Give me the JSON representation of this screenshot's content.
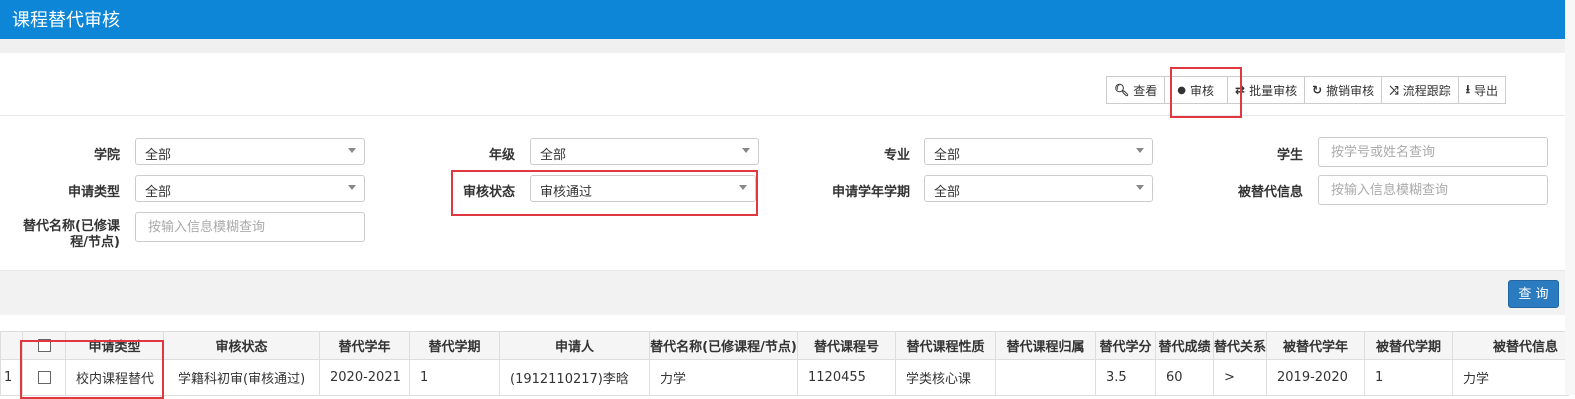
{
  "title": "课程替代审核",
  "toolbar": {
    "buttons": [
      {
        "icon": "search-icon",
        "glyph": "🔍︎",
        "label": "查看"
      },
      {
        "icon": "drop-icon",
        "glyph": "●",
        "label": "审核"
      },
      {
        "icon": "transfer-icon",
        "glyph": "⇄",
        "label": "批量审核"
      },
      {
        "icon": "refresh-icon",
        "glyph": "↻",
        "label": "撤销审核"
      },
      {
        "icon": "shuffle-icon",
        "glyph": "⤨",
        "label": "流程跟踪"
      },
      {
        "icon": "export-icon",
        "glyph": "⭳",
        "label": "导出"
      }
    ]
  },
  "filters": {
    "college_label": "学院",
    "college_value": "全部",
    "grade_label": "年级",
    "grade_value": "全部",
    "major_label": "专业",
    "major_value": "全部",
    "student_label": "学生",
    "student_placeholder": "按学号或姓名查询",
    "apptype_label": "申请类型",
    "apptype_value": "全部",
    "status_label": "审核状态",
    "status_value": "审核通过",
    "term_label": "申请学年学期",
    "term_value": "全部",
    "replaced_label": "被替代信息",
    "replaced_placeholder": "按输入信息模糊查询",
    "subname_label_1": "替代名称(已修课",
    "subname_label_2": "程/节点)",
    "subname_placeholder": "按输入信息模糊查询"
  },
  "query_button": "查 询",
  "table": {
    "headers": [
      "申请类型",
      "审核状态",
      "替代学年",
      "替代学期",
      "申请人",
      "替代名称(已修课程/节点)",
      "替代课程号",
      "替代课程性质",
      "替代课程归属",
      "替代学分",
      "替代成绩",
      "替代关系",
      "被替代学年",
      "被替代学期",
      "被替代信息"
    ],
    "rows": [
      {
        "index": "1",
        "cells": [
          "校内课程替代",
          "学籍科初审(审核通过)",
          "2020-2021",
          "1",
          "(1912110217)李晗",
          "力学",
          "1120455",
          "学类核心课",
          "",
          "3.5",
          "60",
          ">",
          "2019-2020",
          "1",
          "力学"
        ]
      }
    ]
  },
  "colors": {
    "titlebar": "#0d86d8",
    "highlight": "#e0383e",
    "query_button": "#2b7bc0"
  }
}
